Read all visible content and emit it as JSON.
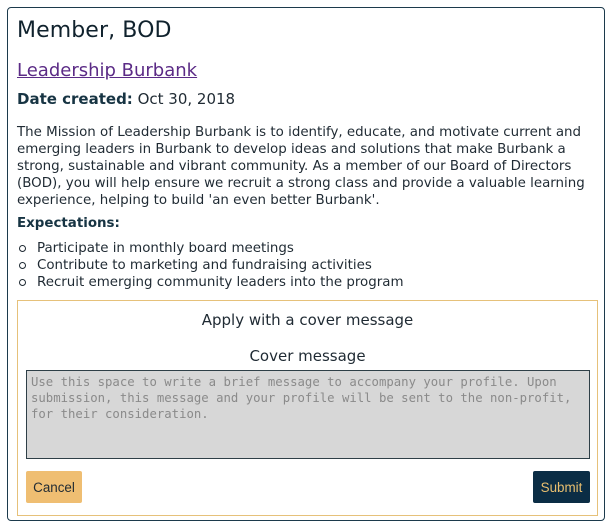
{
  "opportunity": {
    "title": "Member, BOD",
    "organization": "Leadership Burbank",
    "date_label": "Date created:",
    "date_value": "Oct 30, 2018",
    "mission": "The Mission of Leadership Burbank is to identify, educate, and motivate current and emerging leaders in Burbank to develop ideas and solutions that make Burbank a strong, sustainable and vibrant community. As a member of our Board of Directors (BOD), you will help ensure we recruit a strong class and provide a valuable learning experience, helping to build 'an even better Burbank'.",
    "expectations_title": "Expectations:",
    "expectations": [
      "Participate in monthly board meetings",
      "Contribute to marketing and fundraising activities",
      "Recruit emerging community leaders into the program"
    ]
  },
  "apply": {
    "heading": "Apply with a cover message",
    "cover_label": "Cover message",
    "cover_placeholder": "Use this space to write a brief message to accompany your profile. Upon submission, this message and your profile will be sent to the non-profit, for their consideration.",
    "cover_value": "",
    "cancel_label": "Cancel",
    "submit_label": "Submit"
  },
  "colors": {
    "link": "#5b2b86",
    "cancel_bg": "#efbe72",
    "submit_bg": "#0b2d45",
    "submit_text": "#e9bf6f",
    "apply_border": "#e6c17a"
  }
}
